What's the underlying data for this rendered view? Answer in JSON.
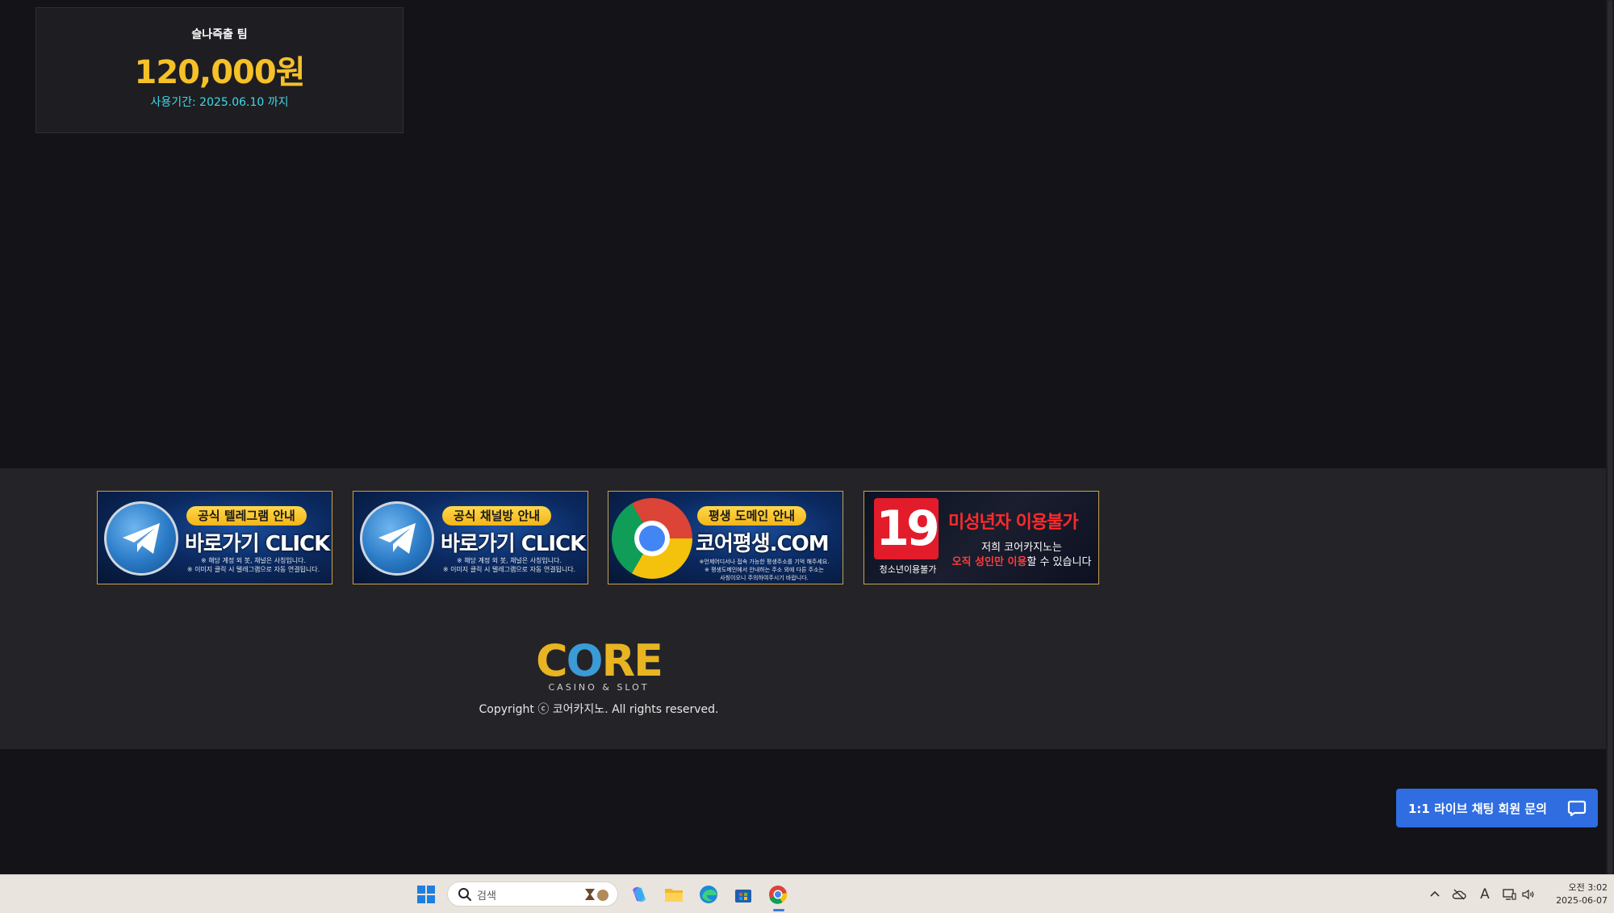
{
  "promo": {
    "title": "슬나즉출 팀",
    "amount": "120,000원",
    "expiry": "사용기간: 2025.06.10 까지"
  },
  "banners": [
    {
      "pill": "공식 텔레그램 안내",
      "main": "바로가기 CLICK",
      "note1": "※ 해당 계정 외 봇, 채널은 사칭입니다.",
      "note2": "※ 이미지 클릭 시 텔레그램으로 자동 연결됩니다."
    },
    {
      "pill": "공식 채널방 안내",
      "main": "바로가기 CLICK",
      "note1": "※ 해당 계정 외 봇, 채널은 사칭입니다.",
      "note2": "※ 이미지 클릭 시 텔레그램으로 자동 연결됩니다."
    },
    {
      "pill": "평생 도메인 안내",
      "main": "코어평생.COM",
      "note1": "※언제어디서나 접속 가능한 평생주소를 기억 해주세요.",
      "note2": "※ 평생도메인에서 안내하는 주소 외에 다른 주소는",
      "note3": "사칭이오니 주의하여주시기 바랍니다."
    },
    {
      "badge": "19",
      "caption": "청소년이용불가",
      "title": "미성년자 이용불가",
      "line1": "저희 코어카지노는",
      "line2_red": "오직 성인만 이용",
      "line2_rest": "할 수 있습니다"
    }
  ],
  "footer": {
    "logo_text_1": "C",
    "logo_text_2": "O",
    "logo_text_3": "RE",
    "logo_sub": "CASINO & SLOT",
    "copyright": "Copyright ⓒ 코어카지노. All rights reserved."
  },
  "chat": {
    "label": "1:1 라이브 채팅 회원 문의"
  },
  "taskbar": {
    "search_placeholder": "검색",
    "clock_time": "오전 3:02",
    "clock_date": "2025-06-07",
    "tray_font_glyph": "A"
  },
  "colors": {
    "background": "#131318",
    "footer_bg": "#242428",
    "promo_amount": "#f6c128",
    "promo_expiry": "#40d9e8",
    "chat_button": "#2f6de0",
    "taskbar": "#e9e4dd"
  }
}
